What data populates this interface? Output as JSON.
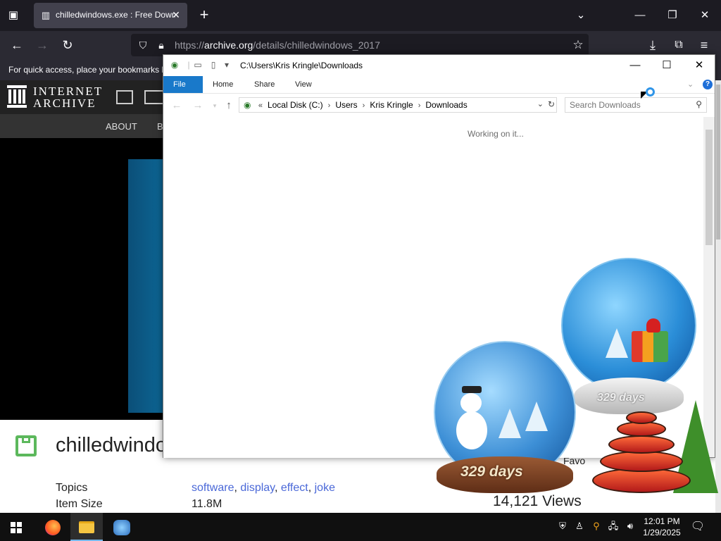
{
  "browser": {
    "tab_title": "chilledwindows.exe : Free Down",
    "url_host": "archive.org",
    "url_prefix": "https://",
    "url_path": "/details/chilledwindows_2017",
    "bookmarks_hint": "For quick access, place your bookmarks h"
  },
  "archive": {
    "logo_line1": "INTERNET",
    "logo_line2": "ARCHIVE",
    "nav": [
      "ABOUT",
      "B"
    ],
    "title": "chilledwindo",
    "topics_label": "Topics",
    "topics": [
      "software",
      "display",
      "effect",
      "joke"
    ],
    "size_label": "Item Size",
    "size_value": "11.8M",
    "views": "14,121 Views",
    "favorites": "Favo"
  },
  "explorer": {
    "title_path": "C:\\Users\\Kris Kringle\\Downloads",
    "ribbon_tabs": [
      "File",
      "Home",
      "Share",
      "View"
    ],
    "breadcrumb": [
      "Local Disk (C:)",
      "Users",
      "Kris Kringle",
      "Downloads"
    ],
    "search_placeholder": "Search Downloads",
    "status": "Working on it..."
  },
  "overlay": {
    "countdown_small": "329 days",
    "countdown_big": "329 days"
  },
  "taskbar": {
    "time": "12:01 PM",
    "date": "1/29/2025"
  },
  "colors": {
    "browser_dark": "#1c1b22",
    "ribbon_file": "#1979ca",
    "link_blue": "#4a68d8",
    "archive_green": "#5cb85c"
  }
}
